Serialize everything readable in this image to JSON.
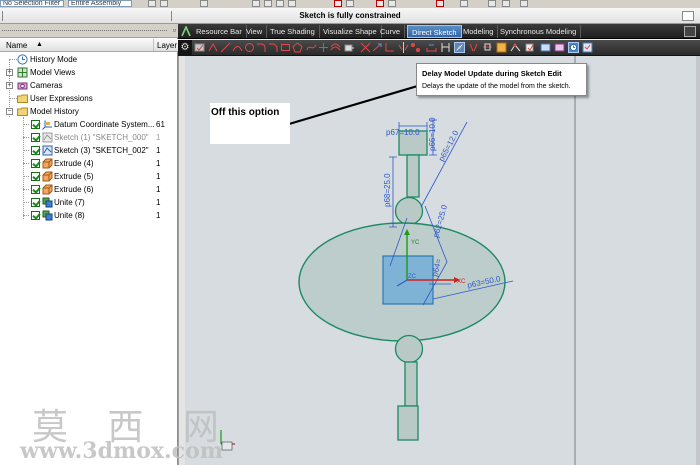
{
  "top_strip": {
    "selection_filter": "No Selection Filter",
    "assembly_scope": "Entire Assembly"
  },
  "status": {
    "message": "Sketch is fully constrained"
  },
  "navigator": {
    "columns": {
      "name": "Name",
      "layer": "Layer"
    },
    "items": [
      {
        "label": "History Mode",
        "layer": "",
        "icon": "history-clock-icon"
      },
      {
        "label": "Model Views",
        "layer": "",
        "icon": "model-views-icon"
      },
      {
        "label": "Cameras",
        "layer": "",
        "icon": "cameras-icon"
      },
      {
        "label": "User Expressions",
        "layer": "",
        "icon": "folder-icon"
      },
      {
        "label": "Model History",
        "layer": "",
        "icon": "folder-icon"
      },
      {
        "label": "Datum Coordinate System...",
        "layer": "61",
        "icon": "datum-csys-icon"
      },
      {
        "label": "Sketch (1) \"SKETCH_000\"",
        "layer": "1",
        "icon": "sketch-icon",
        "dimmed": true
      },
      {
        "label": "Sketch (3) \"SKETCH_002\"",
        "layer": "1",
        "icon": "sketch-icon"
      },
      {
        "label": "Extrude (4)",
        "layer": "1",
        "icon": "extrude-icon"
      },
      {
        "label": "Extrude (5)",
        "layer": "1",
        "icon": "extrude-icon"
      },
      {
        "label": "Extrude (6)",
        "layer": "1",
        "icon": "extrude-icon"
      },
      {
        "label": "Unite (7)",
        "layer": "1",
        "icon": "unite-icon"
      },
      {
        "label": "Unite (8)",
        "layer": "1",
        "icon": "unite-icon"
      }
    ]
  },
  "ribbon": {
    "tabs": [
      "Resource Bar",
      "View",
      "True Shading",
      "Visualize Shape",
      "Curve",
      "Direct Sketch",
      "Modeling",
      "Synchronous Modeling"
    ],
    "active_tab": "Direct Sketch",
    "accent_color": "#3a6fb0"
  },
  "tooltip": {
    "title": "Delay Model Update during Sketch Edit",
    "description": "Delays the update of the model from the sketch."
  },
  "annotation": {
    "text": "Off this option"
  },
  "sketch": {
    "dimensions": {
      "d1": "p67=10.0",
      "d2": "p66=10.0",
      "d3": "p65=12.0",
      "d4": "p68=25.0",
      "d5": "p62=25.0",
      "d6": "p64=",
      "d7": "p63=50.0"
    },
    "axis_labels": {
      "x": "XC",
      "y": "YC",
      "z": "ZC"
    },
    "geometry_color": "#1b8a62",
    "dimension_color": "#2e58c8"
  },
  "watermark": {
    "chinese": "莫 西 网",
    "url": "www.3dmox.com"
  }
}
